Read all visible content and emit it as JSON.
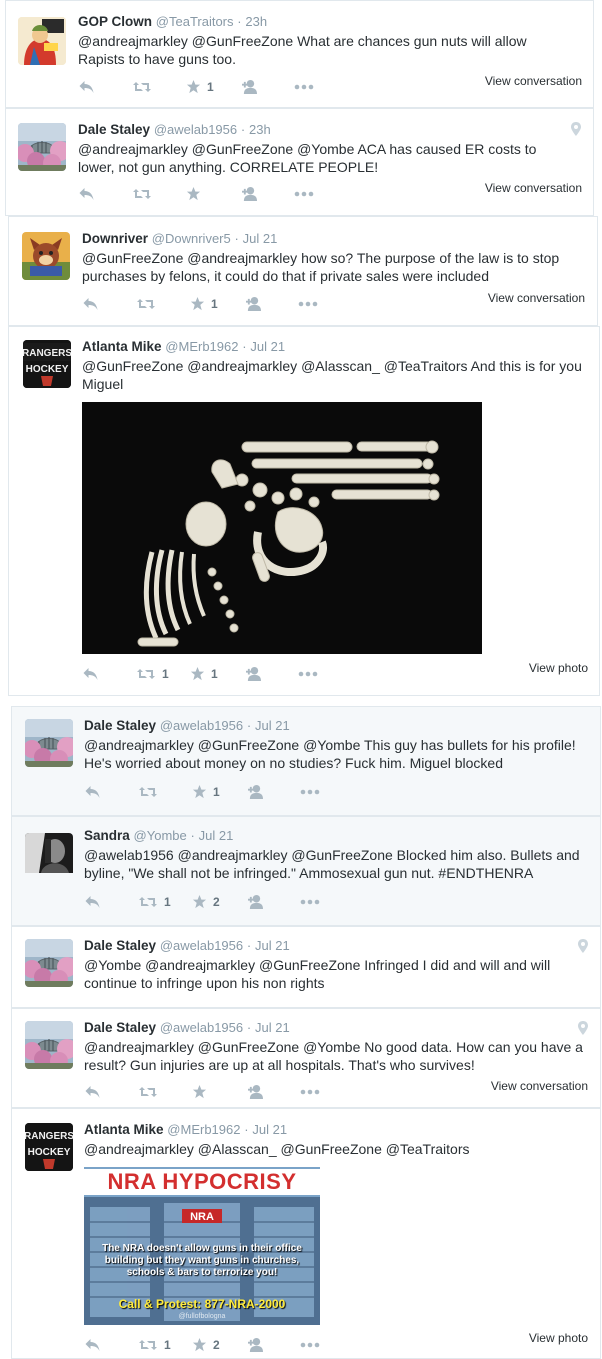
{
  "tweets": [
    {
      "name": "GOP Clown",
      "handle": "@TeaTraitors",
      "time": "23h",
      "text": "@andreajmarkley @GunFreeZone What are chances gun nuts will allow Rapists to have guns too.",
      "retweets": "",
      "likes": "1",
      "link": "View conversation"
    },
    {
      "name": "Dale Staley",
      "handle": "@awelab1956",
      "time": "23h",
      "text": "@andreajmarkley @GunFreeZone @Yombe ACA has caused ER costs to lower, not gun anything. CORRELATE PEOPLE!",
      "retweets": "",
      "likes": "",
      "link": "View conversation"
    },
    {
      "name": "Downriver",
      "handle": "@Downriver5",
      "time": "Jul 21",
      "text": "@GunFreeZone @andreajmarkley how so? The purpose of the law is to stop purchases by felons, it could do that if private sales were included",
      "retweets": "",
      "likes": "1",
      "link": "View conversation"
    },
    {
      "name": "Atlanta Mike",
      "handle": "@MErb1962",
      "time": "Jul 21",
      "text": "@GunFreeZone @andreajmarkley @Alasscan_ @TeaTraitors And this is for you Miguel",
      "retweets": "1",
      "likes": "1",
      "link": "View photo"
    },
    {
      "name": "Dale Staley",
      "handle": "@awelab1956",
      "time": "Jul 21",
      "text": "@andreajmarkley @GunFreeZone @Yombe This guy has bullets for his profile! He's worried about money on no studies? Fuck him. Miguel blocked",
      "retweets": "",
      "likes": "1",
      "link": ""
    },
    {
      "name": "Sandra",
      "handle": "@Yombe",
      "time": "Jul 21",
      "text": "@awelab1956 @andreajmarkley @GunFreeZone Blocked him also. Bullets and byline, \"We shall not be infringed.\" Ammosexual gun nut. #ENDTHENRA",
      "retweets": "1",
      "likes": "2",
      "link": ""
    },
    {
      "name": "Dale Staley",
      "handle": "@awelab1956",
      "time": "Jul 21",
      "text": "@Yombe @andreajmarkley @GunFreeZone Infringed I did and will and will continue to infringe upon his non rights",
      "retweets": "",
      "likes": "",
      "link": ""
    },
    {
      "name": "Dale Staley",
      "handle": "@awelab1956",
      "time": "Jul 21",
      "text": "@andreajmarkley @GunFreeZone @Yombe No good data. How can you have a result? Gun injuries are up at all hospitals. That's who survives!",
      "retweets": "",
      "likes": "",
      "link": "View conversation"
    },
    {
      "name": "Atlanta Mike",
      "handle": "@MErb1962",
      "time": "Jul 21",
      "text": "@andreajmarkley @Alasscan_ @GunFreeZone @TeaTraitors",
      "retweets": "1",
      "likes": "2",
      "link": "View photo"
    }
  ],
  "avatar_text": {
    "rangers": "RANGERS",
    "hockey": "HOCKEY"
  },
  "poster": {
    "title": "NRA HYPOCRISY",
    "sign": "NRA",
    "body": "The NRA doesn't allow guns in their office building but they want guns in churches, schools & bars to terrorize you!",
    "cta": "Call & Protest: 877-NRA-2000",
    "credit": "@fullofbologna"
  },
  "icons": [
    "reply-icon",
    "retweet-icon",
    "like-icon",
    "follow-icon",
    "more-icon",
    "location-pin-icon"
  ]
}
